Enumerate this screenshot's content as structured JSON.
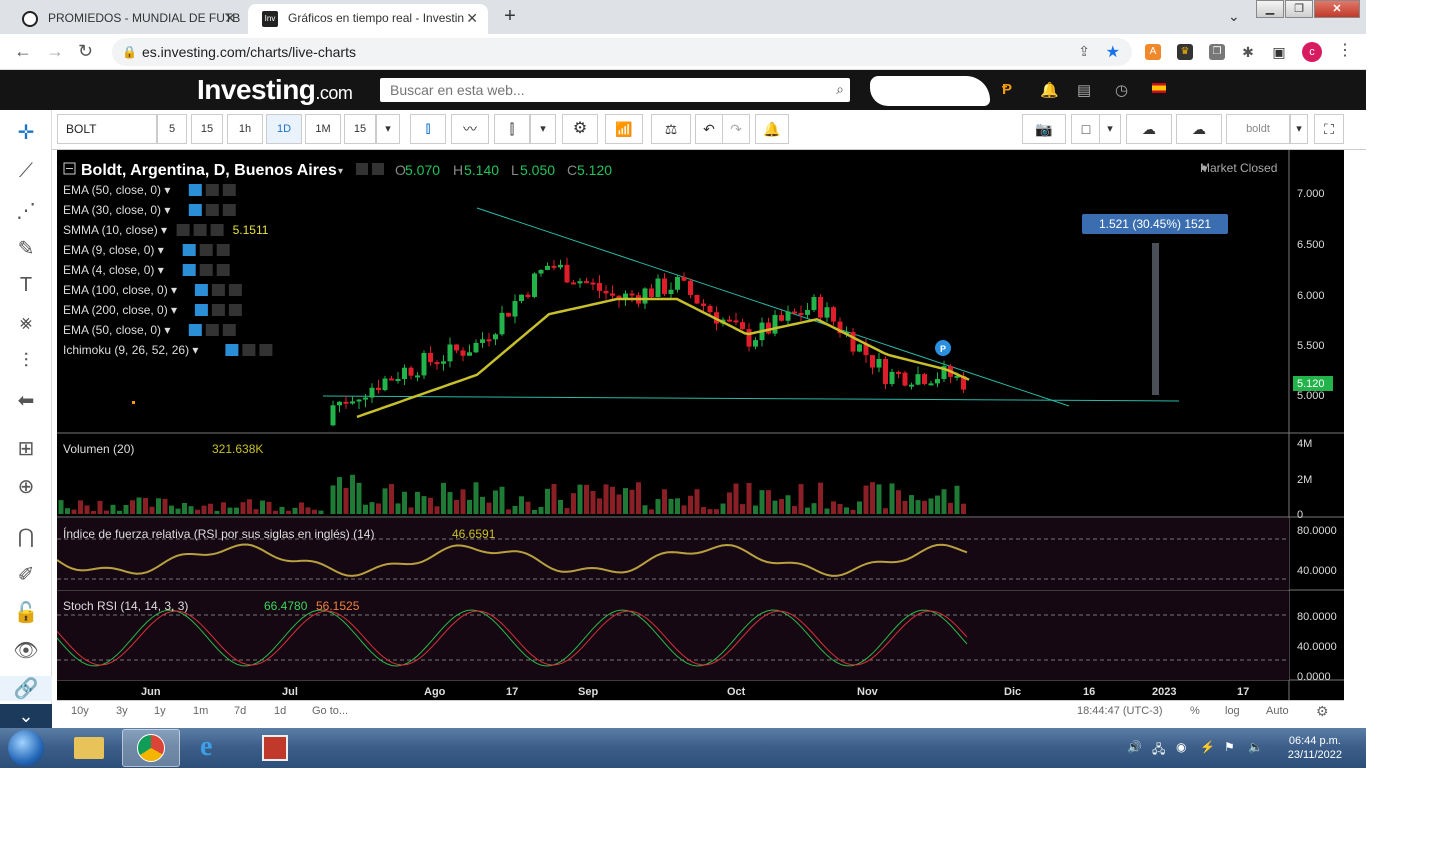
{
  "browser": {
    "tabs": [
      {
        "label": "PROMIEDOS - MUNDIAL DE FUTB",
        "close": "✕"
      },
      {
        "label": "Gráficos en tiempo real - Investin",
        "close": "✕"
      }
    ],
    "new_tab": "+",
    "url": "es.investing.com/charts/live-charts",
    "profile_initial": "c"
  },
  "site": {
    "logo_main": "Investing",
    "logo_suffix": ".com",
    "search_placeholder": "Buscar en esta web..."
  },
  "toolbar": {
    "symbol": "BOLT",
    "intervals": [
      "5",
      "15",
      "1h",
      "1D",
      "1M",
      "15"
    ],
    "selected_interval": "1D",
    "user": "boldt"
  },
  "chart": {
    "legend": {
      "title": "Boldt, Argentina, D, Buenos Aires",
      "o_label": "O",
      "o_value": "5.070",
      "h_label": "H",
      "h_value": "5.140",
      "l_label": "L",
      "l_value": "5.050",
      "c_label": "C",
      "c_value": "5.120"
    },
    "market_status": "Market Closed",
    "indicators": [
      {
        "label": "EMA (50, close, 0)",
        "value": ""
      },
      {
        "label": "EMA (30, close, 0)",
        "value": ""
      },
      {
        "label": "SMMA (10, close)",
        "value": "5.1511"
      },
      {
        "label": "EMA (9, close, 0)",
        "value": ""
      },
      {
        "label": "EMA (4, close, 0)",
        "value": ""
      },
      {
        "label": "EMA (100, close, 0)",
        "value": ""
      },
      {
        "label": "EMA (200, close, 0)",
        "value": ""
      },
      {
        "label": "EMA (50, close, 0)",
        "value": ""
      },
      {
        "label": "Ichimoku (9, 26, 52, 26)",
        "value": ""
      }
    ],
    "measure_label": "1.521 (30.45%) 1521",
    "last_price_tag": "5.120",
    "price_axis": [
      "7.000",
      "6.500",
      "6.000",
      "5.500",
      "5.000"
    ],
    "volume_label": "Volumen (20)",
    "volume_value": "321.638K",
    "volume_axis": [
      "4M",
      "2M",
      "0"
    ],
    "rsi_label": "Índice de fuerza relativa (RSI por sus siglas en inglés) (14)",
    "rsi_value": "46.6591",
    "rsi_axis": [
      "80.0000",
      "40.0000"
    ],
    "stoch_label": "Stoch RSI (14, 14, 3, 3)",
    "stoch_k": "66.4780",
    "stoch_d": "56.1525",
    "stoch_axis": [
      "80.0000",
      "40.0000",
      "0.0000"
    ],
    "time_axis": [
      "Jun",
      "Jul",
      "Ago",
      "17",
      "Sep",
      "Oct",
      "Nov",
      "Dic",
      "16",
      "2023",
      "17"
    ],
    "colors": {
      "up": "#22b34a",
      "down": "#e01e2b",
      "smma": "#c8c02a",
      "trend": "#2ab8a8",
      "volume_up": "#1e7a35",
      "volume_down": "#8a1f26"
    }
  },
  "chart_data": {
    "type": "candlestick",
    "x": [
      "Jul 05",
      "Jul 19",
      "Ago 02",
      "Ago 16",
      "Ago 30",
      "Sep 13",
      "Sep 27",
      "Oct 11",
      "Oct 25",
      "Nov 08",
      "Nov 23"
    ],
    "close": [
      4.9,
      5.25,
      5.5,
      6.3,
      5.95,
      6.1,
      5.55,
      5.9,
      5.2,
      5.2,
      5.12
    ],
    "smma": [
      4.7,
      4.95,
      5.2,
      5.8,
      5.95,
      5.95,
      5.6,
      5.75,
      5.4,
      5.25,
      5.1511
    ],
    "ylim": [
      4.6,
      7.0
    ],
    "last": {
      "open": 5.07,
      "high": 5.14,
      "low": 5.05,
      "close": 5.12
    }
  },
  "bottom": {
    "ranges": [
      "10y",
      "3y",
      "1y",
      "1m",
      "7d",
      "1d"
    ],
    "goto": "Go to...",
    "time": "18:44:47 (UTC-3)",
    "pct": "%",
    "log": "log",
    "auto": "Auto"
  },
  "taskbar": {
    "time": "06:44 p.m.",
    "date": "23/11/2022"
  }
}
